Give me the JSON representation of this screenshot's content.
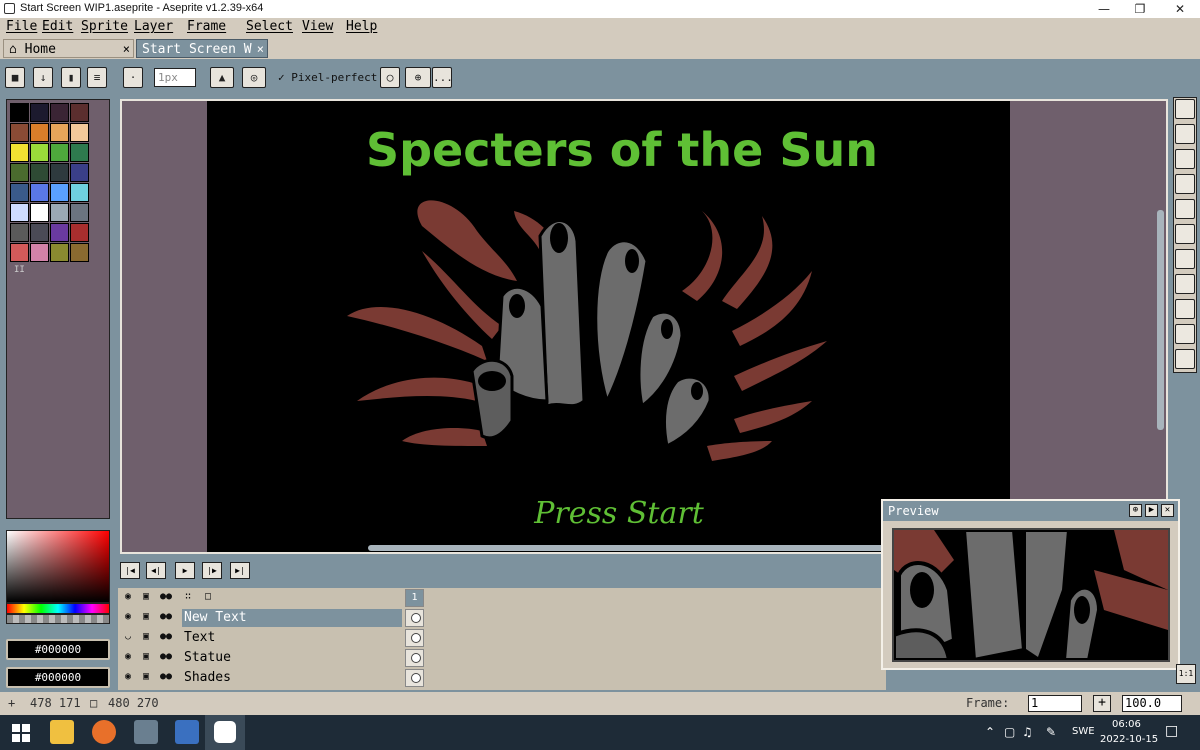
{
  "window": {
    "title": "Start Screen WIP1.aseprite - Aseprite v1.2.39-x64"
  },
  "menu": [
    "File",
    "Edit",
    "Sprite",
    "Layer",
    "Frame",
    "Select",
    "View",
    "Help"
  ],
  "tabs": {
    "home": "Home",
    "start": "Start Screen W",
    "close": "×"
  },
  "context_bar": {
    "brush_size": "1px",
    "pixel_perfect": "Pixel-perfect",
    "more": "..."
  },
  "palette": {
    "swatches": [
      "#000000",
      "#1c1a2e",
      "#3a2434",
      "#5b2e2e",
      "#8a4b35",
      "#d97e2a",
      "#e6a55a",
      "#f3c99a",
      "#f2e232",
      "#9adb3a",
      "#4ea83c",
      "#2e7a4e",
      "#4a6b2e",
      "#2e4a34",
      "#2e3a3e",
      "#3a3f88",
      "#3a5a8a",
      "#5a78e6",
      "#5aa0ff",
      "#6fd0e0",
      "#cfdcff",
      "#ffffff",
      "#9aa8b4",
      "#6b7480",
      "#5a5a5a",
      "#4a4a56",
      "#6a3aa0",
      "#a82e2e",
      "#d25a5a",
      "#d282a8",
      "#8a8a30",
      "#8a6a30"
    ],
    "resize_handle": "II"
  },
  "colors": {
    "foreground": "#000000",
    "background": "#000000"
  },
  "canvas": {
    "title_text": "Specters of the Sun",
    "subtitle_text": "Press Start",
    "title_color": "#5fbf35",
    "flame_color": "#7a3a33",
    "ghost_color": "#6c6c6c"
  },
  "timeline": {
    "frame_header": "1",
    "layers": [
      {
        "name": "New Text",
        "selected": true
      },
      {
        "name": "Text",
        "selected": false
      },
      {
        "name": "Statue",
        "selected": false
      },
      {
        "name": "Shades",
        "selected": false
      }
    ]
  },
  "preview": {
    "title": "Preview"
  },
  "status": {
    "cursor": "478 171",
    "size": "480 270",
    "frame_label": "Frame:",
    "frame_value": "1",
    "zoom": "100.0",
    "plus": "+"
  },
  "taskbar": {
    "lang": "SWE",
    "time": "06:06",
    "date": "2022-10-15"
  }
}
